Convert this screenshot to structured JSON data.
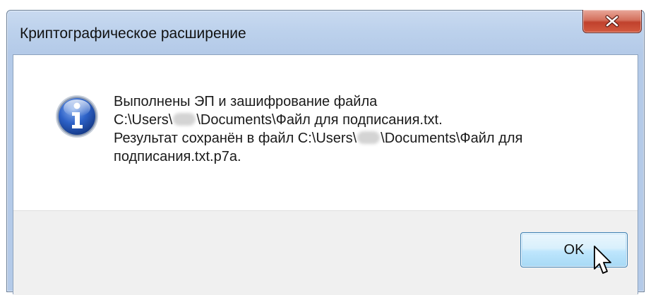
{
  "window": {
    "title": "Криптографическое расширение",
    "close_icon": "close-icon"
  },
  "message": {
    "icon": "info-icon",
    "line1": "Выполнены ЭП и зашифрование файла",
    "line2_a": "C:\\Users\\",
    "line2_b": "\\Documents\\Файл для подписания.txt.",
    "line3_a": "Результат сохранён в файл C:\\Users\\",
    "line3_b": "\\Documents\\Файл для",
    "line4": "подписания.txt.p7a."
  },
  "buttons": {
    "ok_label": "OK"
  },
  "colors": {
    "title_bar": "#bcd1ec",
    "close_button": "#c0412c",
    "ok_button": "#bee6fd",
    "footer": "#f0f0f0"
  }
}
